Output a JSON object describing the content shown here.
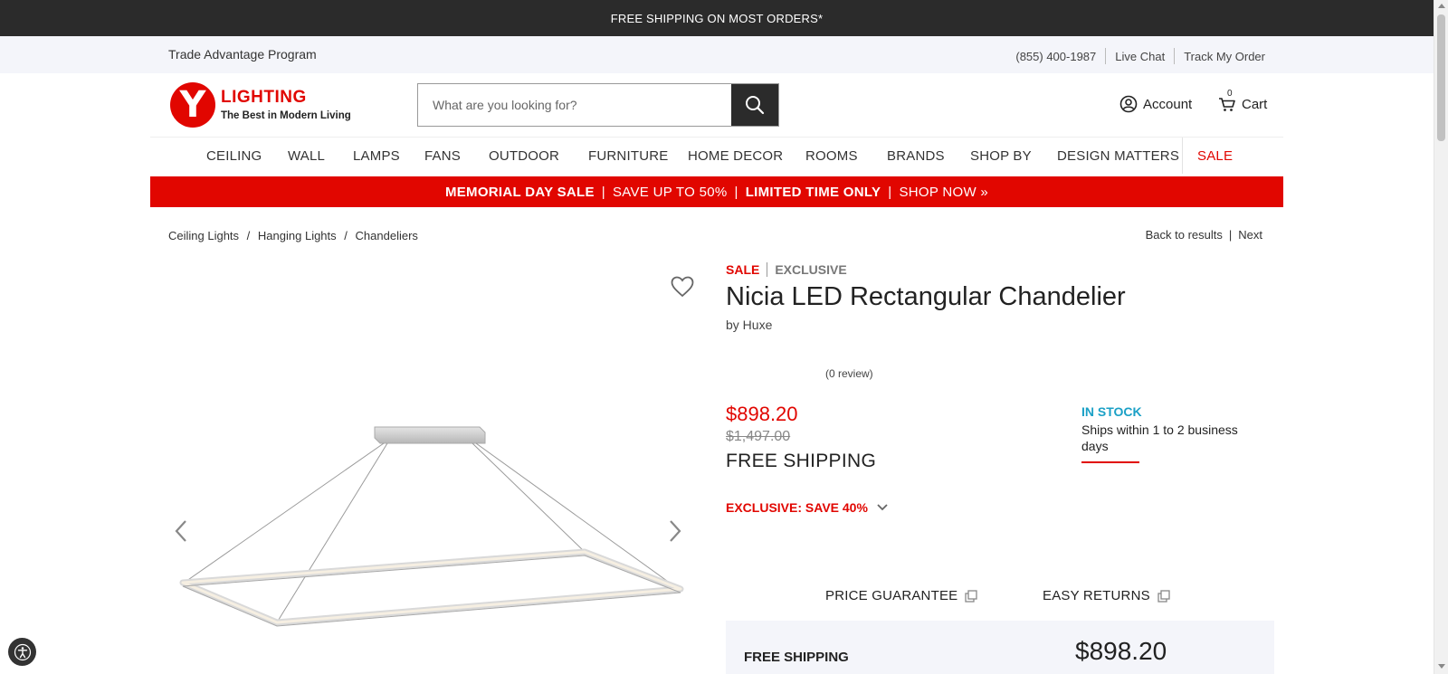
{
  "topbar": {
    "text": "FREE SHIPPING ON MOST ORDERS*"
  },
  "util": {
    "trade": "Trade Advantage Program",
    "phone": "(855) 400-1987",
    "chat": "Live Chat",
    "track": "Track My Order"
  },
  "logo": {
    "letter": "Y",
    "name": "LIGHTING",
    "tagline": "The Best in Modern Living"
  },
  "search": {
    "placeholder": "What are you looking for?"
  },
  "account": {
    "label": "Account"
  },
  "cart": {
    "label": "Cart",
    "count": "0"
  },
  "nav": {
    "items": [
      "CEILING",
      "WALL",
      "LAMPS",
      "FANS",
      "OUTDOOR",
      "FURNITURE",
      "HOME DECOR",
      "ROOMS",
      "BRANDS",
      "SHOP BY",
      "DESIGN MATTERS",
      "SALE"
    ]
  },
  "promo": {
    "part1": "MEMORIAL DAY SALE",
    "part2": "SAVE UP TO 50%",
    "part3": "LIMITED TIME ONLY",
    "part4": "SHOP NOW »",
    "divider": "|"
  },
  "breadcrumb": {
    "items": [
      "Ceiling Lights",
      "Hanging Lights",
      "Chandeliers"
    ],
    "separator": "/"
  },
  "results_nav": {
    "back": "Back to results",
    "next": "Next",
    "divider": "|"
  },
  "product": {
    "tag_sale": "SALE",
    "tag_exclusive": "EXCLUSIVE",
    "title": "Nicia LED Rectangular Chandelier",
    "by": "by Huxe",
    "review": "(0 review)",
    "price": "$898.20",
    "old_price": "$1,497.00",
    "free_shipping": "FREE SHIPPING",
    "stock_status": "IN STOCK",
    "stock_ship": "Ships within 1 to 2 business days",
    "exclusive_save": "EXCLUSIVE: SAVE 40%",
    "price_guarantee": "PRICE GUARANTEE",
    "easy_returns": "EASY RETURNS"
  },
  "summary": {
    "free_shipping": "FREE SHIPPING",
    "price": "$898.20"
  },
  "colors": {
    "brand_red": "#e10600",
    "dark": "#2b2b2b",
    "stock_blue": "#1aa0c6",
    "light_bg": "#f4f5fa"
  }
}
